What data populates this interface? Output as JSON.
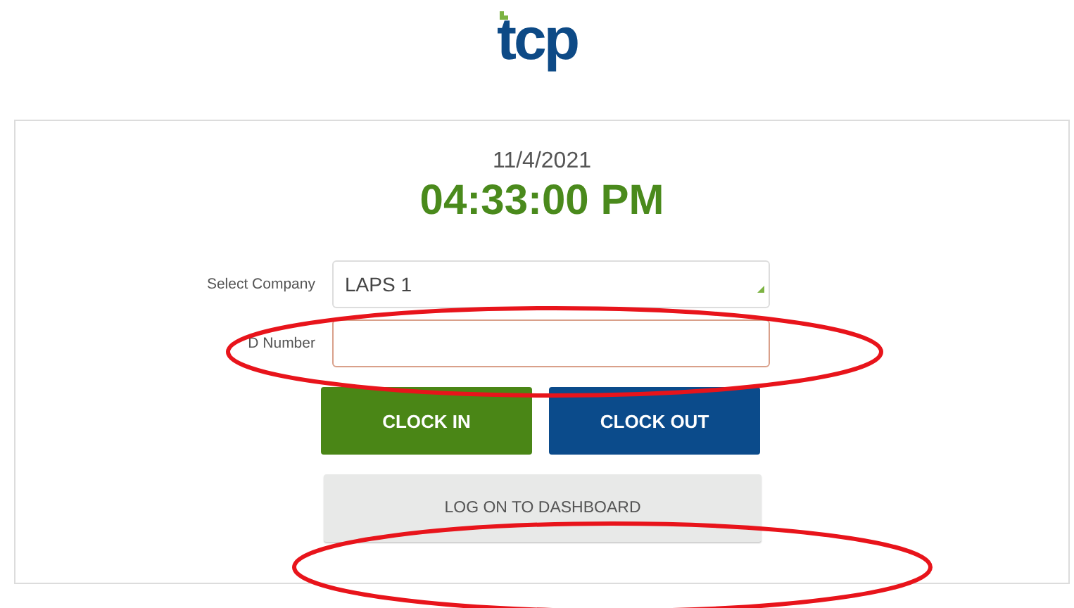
{
  "logo": {
    "text": "tcp"
  },
  "date": "11/4/2021",
  "time": "04:33:00 PM",
  "fields": [
    {
      "label": "Select Company",
      "kind": "select",
      "value": "LAPS  1"
    },
    {
      "label": "D Number",
      "kind": "text"
    }
  ],
  "buttons": [
    {
      "label": "CLOCK IN",
      "kind": "primary"
    },
    {
      "label": "CLOCK OUT",
      "kind": "secondary"
    }
  ],
  "dashboard_button": {
    "label": "LOG ON TO DASHBOARD"
  }
}
